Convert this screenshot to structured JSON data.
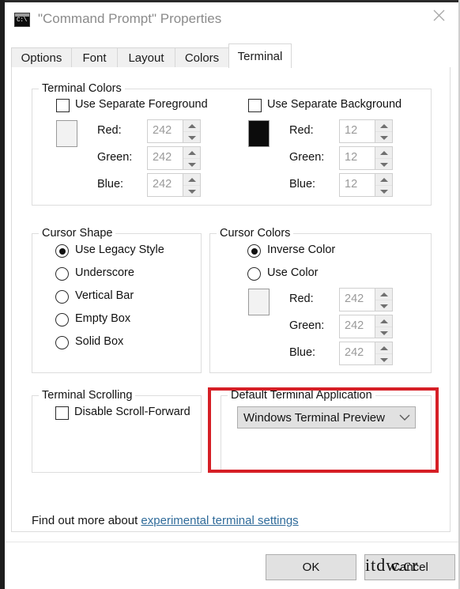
{
  "window": {
    "title": "\"Command Prompt\" Properties",
    "icon": "command-prompt-icon",
    "icon_text": "C:\\",
    "close_label": "✕"
  },
  "tabs": [
    {
      "label": "Options",
      "active": false
    },
    {
      "label": "Font",
      "active": false
    },
    {
      "label": "Layout",
      "active": false
    },
    {
      "label": "Colors",
      "active": false
    },
    {
      "label": "Terminal",
      "active": true
    }
  ],
  "terminal_colors": {
    "legend": "Terminal Colors",
    "foreground": {
      "checkbox_label": "Use Separate Foreground",
      "checked": false,
      "swatch_color": "#f2f2f2",
      "channels": [
        {
          "label": "Red:",
          "value": "242"
        },
        {
          "label": "Green:",
          "value": "242"
        },
        {
          "label": "Blue:",
          "value": "242"
        }
      ]
    },
    "background": {
      "checkbox_label": "Use Separate Background",
      "checked": false,
      "swatch_color": "#0c0c0c",
      "channels": [
        {
          "label": "Red:",
          "value": "12"
        },
        {
          "label": "Green:",
          "value": "12"
        },
        {
          "label": "Blue:",
          "value": "12"
        }
      ]
    }
  },
  "cursor_shape": {
    "legend": "Cursor Shape",
    "options": [
      {
        "label": "Use Legacy Style",
        "selected": true
      },
      {
        "label": "Underscore",
        "selected": false
      },
      {
        "label": "Vertical Bar",
        "selected": false
      },
      {
        "label": "Empty Box",
        "selected": false
      },
      {
        "label": "Solid Box",
        "selected": false
      }
    ]
  },
  "cursor_colors": {
    "legend": "Cursor Colors",
    "options": [
      {
        "label": "Inverse Color",
        "selected": true
      },
      {
        "label": "Use Color",
        "selected": false
      }
    ],
    "swatch_color": "#f2f2f2",
    "channels": [
      {
        "label": "Red:",
        "value": "242"
      },
      {
        "label": "Green:",
        "value": "242"
      },
      {
        "label": "Blue:",
        "value": "242"
      }
    ]
  },
  "terminal_scrolling": {
    "legend": "Terminal Scrolling",
    "checkbox_label": "Disable Scroll-Forward",
    "checked": false
  },
  "default_terminal_application": {
    "legend": "Default Terminal Application",
    "selected": "Windows Terminal Preview",
    "highlight_color": "#d61f26"
  },
  "footer": {
    "prefix": "Find out more about ",
    "link": "experimental terminal settings",
    "ok_label": "OK",
    "cancel_label": "Cancel"
  },
  "watermark": {
    "text": "itdw.cr"
  }
}
